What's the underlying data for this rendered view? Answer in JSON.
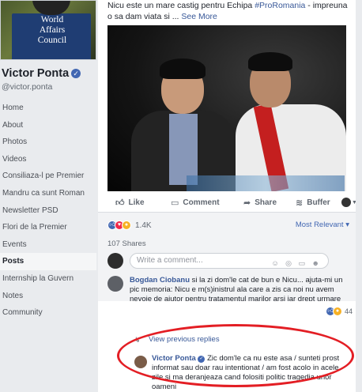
{
  "sidebar": {
    "cover_text": [
      "World",
      "Affairs",
      "Council"
    ],
    "profile_name": "Victor Ponta",
    "verified_symbol": "✓",
    "handle": "@victor.ponta",
    "nav": [
      "Home",
      "About",
      "Photos",
      "Videos",
      "Consiliaza-l pe Premier",
      "Mandru ca sunt Roman",
      "Newsletter PSD",
      "Flori de la Premier",
      "Events",
      "Posts",
      "Internship la Guvern",
      "Notes",
      "Community"
    ],
    "active_item": "Posts"
  },
  "post": {
    "text_before": "Nicu este un mare castig pentru Echipa ",
    "hashtag": "#ProRomania",
    "text_after": " - impreuna o sa dam viata si ... ",
    "see_more": "See More",
    "actions": {
      "like": "Like",
      "comment": "Comment",
      "share": "Share",
      "buffer": "Buffer"
    },
    "reaction_count": "1.4K",
    "sort_label": "Most Relevant",
    "sort_caret": "▾",
    "shares": "107 Shares",
    "write_placeholder": "Write a comment...",
    "write_icons": "☺ ◎ ▭ ☻"
  },
  "comment1": {
    "author": "Bogdan Ciobanu",
    "text": "si la zi dom'le cat de bun e Nicu... ajuta-mi un pic memoria: Nicu e m(s)inistrul ala care a zis ca noi nu avem nevoie de ajutor pentru tratamentul marilor arsi iar drept urmare au murit tineri cu zile? asta e Nicu pe care il lauzi? ne' bravo .....",
    "reaction_count": "44"
  },
  "replies": {
    "view_previous": "View previous replies",
    "reply_arrow": "↳",
    "author": "Victor Ponta",
    "text": "Zic dom'le ca nu este asa / sunteti prost informat sau doar rau intentionat / am fost acolo in acele zile si ma deranjeaza cand folositi politic tragedia unor oameni"
  },
  "icons": {
    "like": "like-icon",
    "comment": "comment-icon",
    "share": "share-icon",
    "buffer": "buffer-icon",
    "verified": "verified-badge-icon"
  },
  "colors": {
    "facebook_blue": "#4267b2",
    "link_blue": "#385898",
    "highlight_red": "#e31e24",
    "scarf_red": "#c41f1f"
  }
}
